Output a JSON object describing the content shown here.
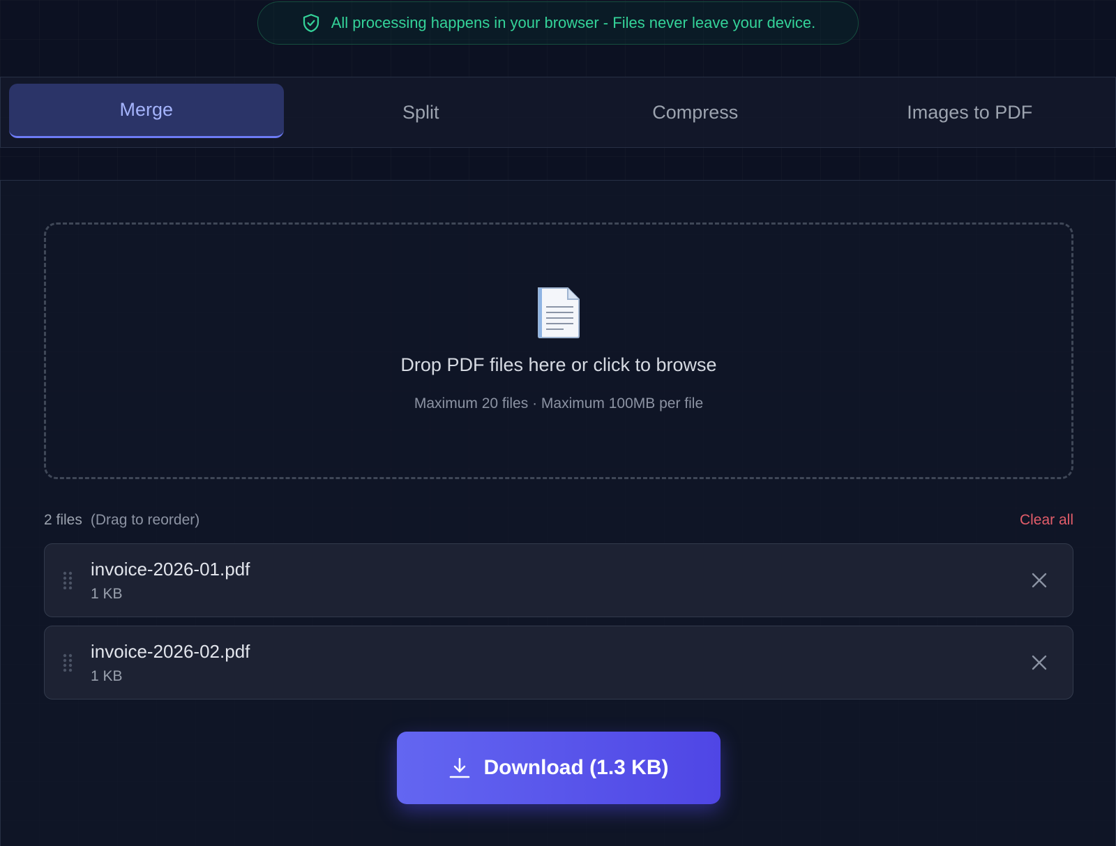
{
  "privacy_banner": {
    "icon": "shield-check-icon",
    "text": "All processing happens in your browser - Files never leave your device."
  },
  "tabs": [
    {
      "label": "Merge",
      "active": true
    },
    {
      "label": "Split",
      "active": false
    },
    {
      "label": "Compress",
      "active": false
    },
    {
      "label": "Images to PDF",
      "active": false
    }
  ],
  "dropzone": {
    "icon": "document-icon",
    "title": "Drop PDF files here or click to browse",
    "subtitle": "Maximum 20 files · Maximum 100MB per file"
  },
  "files": {
    "count_label": "2 files",
    "hint": "(Drag to reorder)",
    "clear_label": "Clear all",
    "items": [
      {
        "name": "invoice-2026-01.pdf",
        "size": "1 KB"
      },
      {
        "name": "invoice-2026-02.pdf",
        "size": "1 KB"
      }
    ]
  },
  "download": {
    "icon": "download-icon",
    "label": "Download (1.3 KB)"
  },
  "colors": {
    "accent": "#6366f1",
    "success": "#34d399",
    "danger": "#e35d6a",
    "background": "#0c1122"
  }
}
